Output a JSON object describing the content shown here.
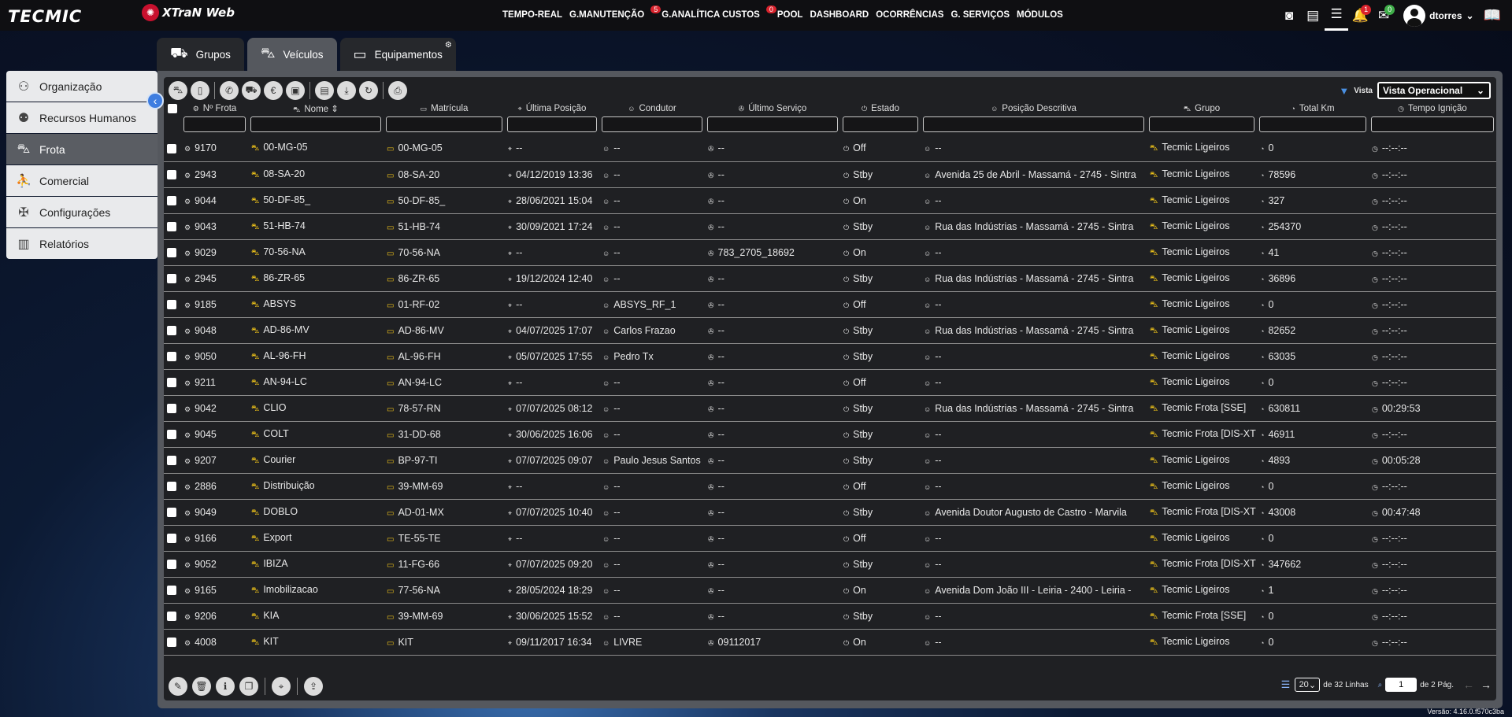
{
  "brand": {
    "logo": "TECMIC",
    "product": "XTraN Web"
  },
  "topnav": [
    {
      "label": "TEMPO-REAL",
      "badge": ""
    },
    {
      "label": "G.MANUTENÇÃO",
      "badge": "5"
    },
    {
      "label": "G.ANALÍTICA CUSTOS",
      "badge": "0"
    },
    {
      "label": "POOL",
      "badge": ""
    },
    {
      "label": "DASHBOARD",
      "badge": ""
    },
    {
      "label": "OCORRÊNCIAS",
      "badge": ""
    },
    {
      "label": "G. SERVIÇOS",
      "badge": ""
    },
    {
      "label": "MÓDULOS",
      "badge": ""
    }
  ],
  "header_icons": {
    "notifications_badge": "1",
    "messages_badge": "0",
    "username": "dtorres"
  },
  "tabs": [
    "Grupos",
    "Veículos",
    "Equipamentos"
  ],
  "sidebar": [
    "Organização",
    "Recursos Humanos",
    "Frota",
    "Comercial",
    "Configurações",
    "Relatórios"
  ],
  "vista": {
    "label": "Vista",
    "selected": "Vista Operacional"
  },
  "columns": [
    "Nº Frota",
    "Nome",
    "Matrícula",
    "Última Posição",
    "Condutor",
    "Último Serviço",
    "Estado",
    "Posição Descritiva",
    "Grupo",
    "Total Km",
    "Tempo Ignição"
  ],
  "rows": [
    [
      "9170",
      "00-MG-05",
      "00-MG-05",
      "--",
      "--",
      "--",
      "Off",
      "--",
      "Tecmic Ligeiros",
      "0",
      "--:--:--"
    ],
    [
      "2943",
      "08-SA-20",
      "08-SA-20",
      "04/12/2019 13:36",
      "--",
      "--",
      "Stby",
      "Avenida 25 de Abril - Massamá - 2745 - Sintra",
      "Tecmic Ligeiros",
      "78596",
      "--:--:--"
    ],
    [
      "9044",
      "50-DF-85_",
      "50-DF-85_",
      "28/06/2021 15:04",
      "--",
      "--",
      "On",
      "--",
      "Tecmic Ligeiros",
      "327",
      "--:--:--"
    ],
    [
      "9043",
      "51-HB-74",
      "51-HB-74",
      "30/09/2021 17:24",
      "--",
      "--",
      "Stby",
      "Rua das Indústrias - Massamá - 2745 - Sintra",
      "Tecmic Ligeiros",
      "254370",
      "--:--:--"
    ],
    [
      "9029",
      "70-56-NA",
      "70-56-NA",
      "--",
      "--",
      "783_2705_18692",
      "On",
      "--",
      "Tecmic Ligeiros",
      "41",
      "--:--:--"
    ],
    [
      "2945",
      "86-ZR-65",
      "86-ZR-65",
      "19/12/2024 12:40",
      "--",
      "--",
      "Stby",
      "Rua das Indústrias - Massamá - 2745 - Sintra",
      "Tecmic Ligeiros",
      "36896",
      "--:--:--"
    ],
    [
      "9185",
      "ABSYS",
      "01-RF-02",
      "--",
      "ABSYS_RF_1",
      "--",
      "Off",
      "--",
      "Tecmic Ligeiros",
      "0",
      "--:--:--"
    ],
    [
      "9048",
      "AD-86-MV",
      "AD-86-MV",
      "04/07/2025 17:07",
      "Carlos Frazao",
      "--",
      "Stby",
      "Rua das Indústrias - Massamá - 2745 - Sintra",
      "Tecmic Ligeiros",
      "82652",
      "--:--:--"
    ],
    [
      "9050",
      "AL-96-FH",
      "AL-96-FH",
      "05/07/2025 17:55",
      "Pedro Tx",
      "--",
      "Stby",
      "--",
      "Tecmic Ligeiros",
      "63035",
      "--:--:--"
    ],
    [
      "9211",
      "AN-94-LC",
      "AN-94-LC",
      "--",
      "--",
      "--",
      "Off",
      "--",
      "Tecmic Ligeiros",
      "0",
      "--:--:--"
    ],
    [
      "9042",
      "CLIO",
      "78-57-RN",
      "07/07/2025 08:12",
      "--",
      "--",
      "Stby",
      "Rua das Indústrias - Massamá - 2745 - Sintra",
      "Tecmic Frota [SSE]",
      "630811",
      "00:29:53"
    ],
    [
      "9045",
      "COLT",
      "31-DD-68",
      "30/06/2025 16:06",
      "--",
      "--",
      "Stby",
      "--",
      "Tecmic Frota [DIS-XT",
      "46911",
      "--:--:--"
    ],
    [
      "9207",
      "Courier",
      "BP-97-TI",
      "07/07/2025 09:07",
      "Paulo Jesus Santos",
      "--",
      "Stby",
      "--",
      "Tecmic Ligeiros",
      "4893",
      "00:05:28"
    ],
    [
      "2886",
      "Distribuição",
      "39-MM-69",
      "--",
      "--",
      "--",
      "Off",
      "--",
      "Tecmic Ligeiros",
      "0",
      "--:--:--"
    ],
    [
      "9049",
      "DOBLO",
      "AD-01-MX",
      "07/07/2025 10:40",
      "--",
      "--",
      "Stby",
      "Avenida Doutor Augusto de Castro - Marvila",
      "Tecmic Frota [DIS-XT",
      "43008",
      "00:47:48"
    ],
    [
      "9166",
      "Export",
      "TE-55-TE",
      "--",
      "--",
      "--",
      "Off",
      "--",
      "Tecmic Ligeiros",
      "0",
      "--:--:--"
    ],
    [
      "9052",
      "IBIZA",
      "11-FG-66",
      "07/07/2025 09:20",
      "--",
      "--",
      "Stby",
      "--",
      "Tecmic Frota [DIS-XT",
      "347662",
      "--:--:--"
    ],
    [
      "9165",
      "Imobilizacao",
      "77-56-NA",
      "28/05/2024 18:29",
      "--",
      "--",
      "On",
      "Avenida Dom João III - Leiria - 2400 - Leiria -",
      "Tecmic Ligeiros",
      "1",
      "--:--:--"
    ],
    [
      "9206",
      "KIA",
      "39-MM-69",
      "30/06/2025 15:52",
      "--",
      "--",
      "Stby",
      "--",
      "Tecmic Frota [SSE]",
      "0",
      "--:--:--"
    ],
    [
      "4008",
      "KIT",
      "KIT",
      "09/11/2017 16:34",
      "LIVRE",
      "09112017",
      "On",
      "--",
      "Tecmic Ligeiros",
      "0",
      "--:--:--"
    ]
  ],
  "pagination": {
    "per_page": "20",
    "lines_text": "de 32 Linhas",
    "page": "1",
    "pages_text": "de 2 Pág."
  },
  "version": "Versão: 4.16.0.f570c3ba"
}
